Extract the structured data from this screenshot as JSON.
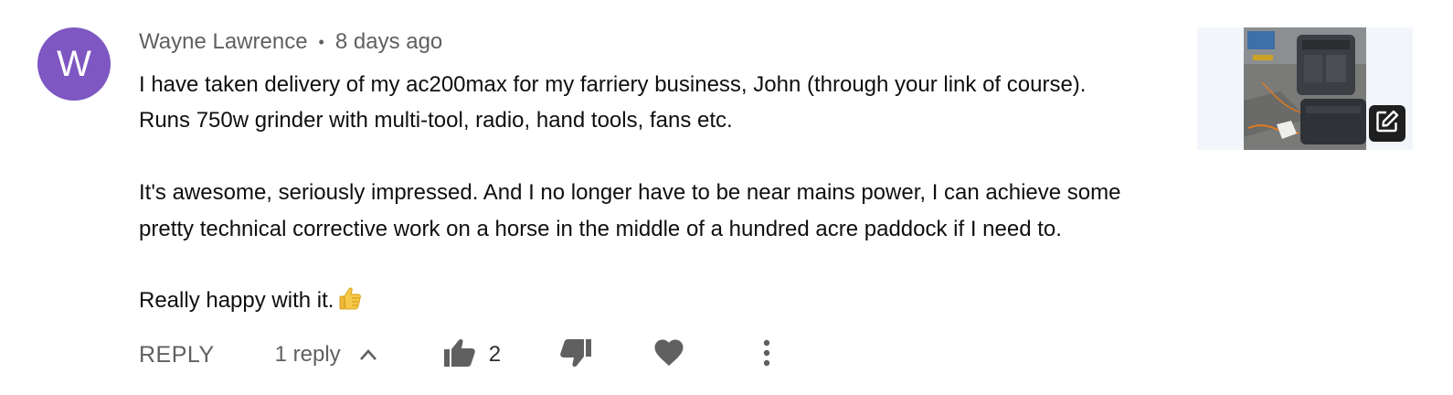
{
  "comment": {
    "avatar_letter": "W",
    "author": "Wayne Lawrence",
    "separator": "•",
    "timestamp": "8 days ago",
    "lines": [
      "I have taken delivery of my ac200max for my farriery business, John (through your link of course).",
      "Runs 750w grinder with multi-tool, radio, hand tools, fans etc.",
      "It's awesome, seriously impressed. And I no longer have to be near mains power, I can achieve some",
      "pretty technical corrective work on a horse in the middle of a hundred acre paddock if I need to.",
      "Really happy with it."
    ]
  },
  "actions": {
    "reply_label": "REPLY",
    "replies_label": "1 reply",
    "like_count": "2"
  },
  "colors": {
    "avatar": "#7e57c2",
    "secondary_text": "#606060",
    "icon": "#606060"
  },
  "icons": [
    "chevron-up-icon",
    "thumbs-up-icon",
    "thumbs-down-icon",
    "heart-icon",
    "more-vert-icon",
    "edit-icon",
    "thumbs-up-emoji"
  ]
}
